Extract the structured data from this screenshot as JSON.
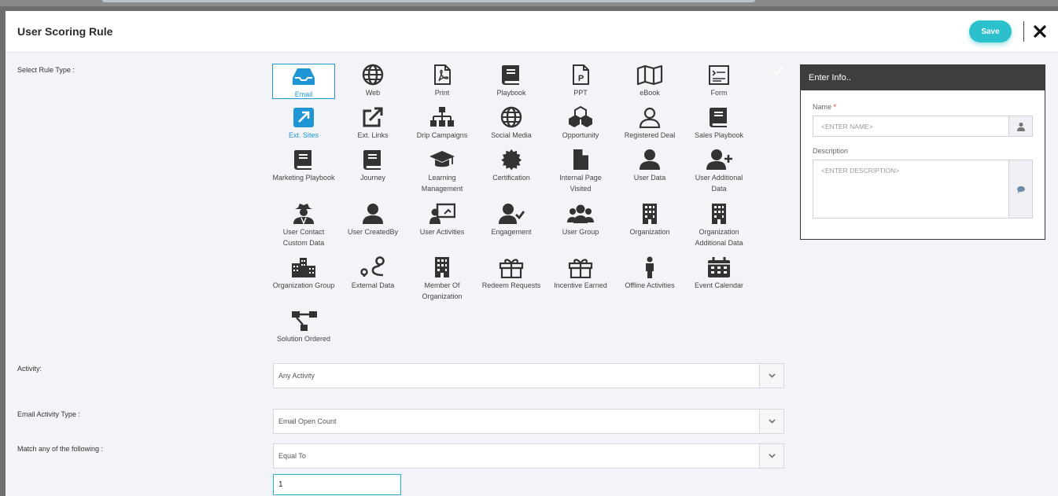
{
  "modal": {
    "title": "User Scoring Rule",
    "save_label": "Save"
  },
  "labels": {
    "rule_type": "Select Rule Type :",
    "activity": "Activity:",
    "email_activity_type": "Email Activity Type :",
    "match": "Match any of the following :"
  },
  "rule_types": [
    {
      "label": "Email",
      "icon": "inbox-icon",
      "selected": true
    },
    {
      "label": "Web",
      "icon": "globe-icon"
    },
    {
      "label": "Print",
      "icon": "pdf-file-icon"
    },
    {
      "label": "Playbook",
      "icon": "book-icon"
    },
    {
      "label": "PPT",
      "icon": "ppt-file-icon"
    },
    {
      "label": "eBook",
      "icon": "map-icon"
    },
    {
      "label": "Form",
      "icon": "form-icon"
    },
    {
      "label": "Ext. Sites",
      "icon": "external-arrow-icon",
      "highlight": true
    },
    {
      "label": "Ext. Links",
      "icon": "external-link-icon"
    },
    {
      "label": "Drip Campaigns",
      "icon": "sitemap-icon"
    },
    {
      "label": "Social Media",
      "icon": "globe-icon"
    },
    {
      "label": "Opportunity",
      "icon": "cubes-icon"
    },
    {
      "label": "Registered Deal",
      "icon": "user-outline-icon"
    },
    {
      "label": "Sales Playbook",
      "icon": "book-icon"
    },
    {
      "label": "Marketing Playbook",
      "icon": "book-icon"
    },
    {
      "label": "Journey",
      "icon": "book-icon"
    },
    {
      "label": "Learning Management",
      "icon": "graduation-cap-icon"
    },
    {
      "label": "Certification",
      "icon": "certificate-icon"
    },
    {
      "label": "Internal Page Visited",
      "icon": "file-icon"
    },
    {
      "label": "User Data",
      "icon": "user-icon"
    },
    {
      "label": "User Additional Data",
      "icon": "user-plus-icon"
    },
    {
      "label": "User Contact Custom Data",
      "icon": "user-secret-icon"
    },
    {
      "label": "User CreatedBy",
      "icon": "user-icon"
    },
    {
      "label": "User Activities",
      "icon": "chalkboard-user-icon"
    },
    {
      "label": "Engagement",
      "icon": "user-check-icon"
    },
    {
      "label": "User Group",
      "icon": "users-icon"
    },
    {
      "label": "Organization",
      "icon": "building-icon"
    },
    {
      "label": "Organization Additional Data",
      "icon": "building-icon"
    },
    {
      "label": "Organization Group",
      "icon": "city-icon"
    },
    {
      "label": "External Data",
      "icon": "route-icon"
    },
    {
      "label": "Member Of Organization",
      "icon": "building-icon"
    },
    {
      "label": "Redeem Requests",
      "icon": "gift-icon"
    },
    {
      "label": "Incentive Earned",
      "icon": "gift-icon"
    },
    {
      "label": "Offline Activities",
      "icon": "person-icon"
    },
    {
      "label": "Event Calendar",
      "icon": "calendar-icon"
    },
    {
      "label": "Solution Ordered",
      "icon": "diagram-icon"
    }
  ],
  "activity_select": {
    "value": "Any Activity"
  },
  "email_activity_select": {
    "value": "Email Open Count"
  },
  "match_select": {
    "value": "Equal To"
  },
  "match_value": "1",
  "info_panel": {
    "title": "Enter Info..",
    "name_label": "Name",
    "required_mark": "*",
    "name_placeholder": "<ENTER NAME>",
    "description_label": "Description",
    "description_placeholder": "<ENTER DESCRIPTION>"
  },
  "colors": {
    "accent": "#2bc0cc",
    "selected": "#1f95d5",
    "panel_header": "#3e3e3e"
  }
}
